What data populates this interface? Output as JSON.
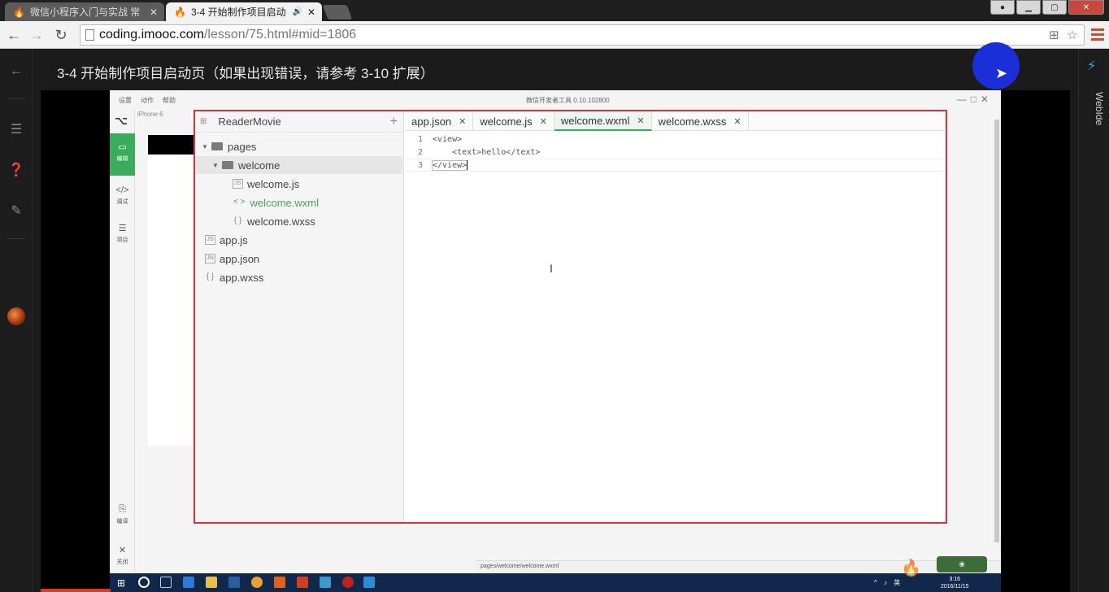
{
  "browser": {
    "tabs": [
      {
        "title": "微信小程序入门与实战 常",
        "close": "✕"
      },
      {
        "title": "3-4 开始制作项目启动",
        "close": "✕"
      }
    ],
    "url_host": "coding.imooc.com",
    "url_path": "/lesson/75.html#mid=1806"
  },
  "page": {
    "lesson_title": "3-4 开始制作项目启动页（如果出现错误，请参考 3-10 扩展）",
    "right_panel_label": "WebIde"
  },
  "ide": {
    "menu": [
      "设置",
      "动作",
      "帮助"
    ],
    "window_title": "微信开发者工具 0.10.102800",
    "left_buttons": [
      {
        "glyph": "▭",
        "label": "编辑"
      },
      {
        "glyph": "</>",
        "label": "调试"
      },
      {
        "glyph": "☰",
        "label": "项目"
      },
      {
        "glyph": "⎘",
        "label": "编译"
      },
      {
        "glyph": "✕",
        "label": "关闭"
      }
    ],
    "device": "iPhone 6",
    "project_name": "ReaderMovie",
    "tree": {
      "pages": "pages",
      "welcome": "welcome",
      "welcome_js": "welcome.js",
      "welcome_wxml": "welcome.wxml",
      "welcome_wxss": "welcome.wxss",
      "app_js": "app.js",
      "app_json": "app.json",
      "app_wxss": "app.wxss",
      "icon_js": "JS",
      "icon_json": "JN",
      "icon_xml": "< >",
      "icon_css": "{ }"
    },
    "editor_tabs": [
      "app.json",
      "welcome.js",
      "welcome.wxml",
      "welcome.wxss"
    ],
    "active_tab": "welcome.wxml",
    "code_lines": [
      {
        "n": "1",
        "text": "<view>"
      },
      {
        "n": "2",
        "text": "    <text>hello</text>"
      },
      {
        "n": "3",
        "text": "</view>"
      }
    ],
    "status_path": "pages/welcome/welcome.wxml",
    "clock_time": "3:16",
    "clock_date": "2016/11/15",
    "tray": "^ ♪ 英"
  },
  "colors": {
    "accent_green": "#3bac5c",
    "frame_red": "#d6333a",
    "brand_red": "#d14a2a",
    "cursor_blue": "#1a2fd8"
  }
}
